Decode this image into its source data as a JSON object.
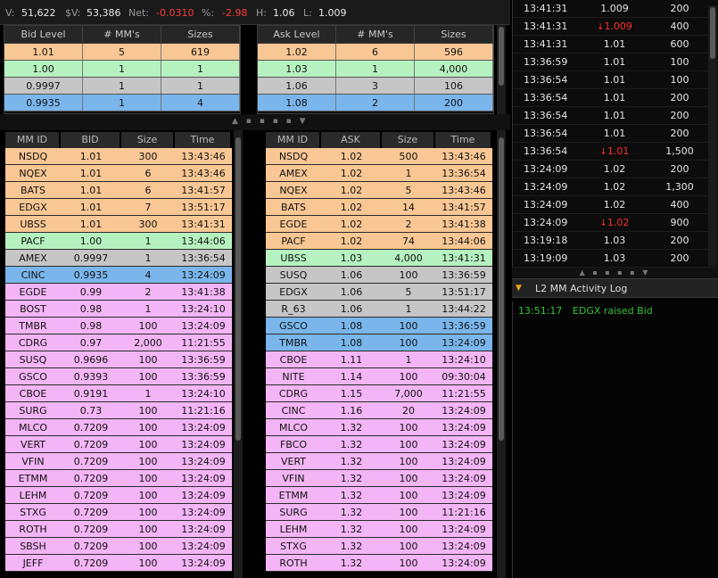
{
  "info": {
    "v_label": "V:",
    "v_value": "51,622",
    "dv_label": "$V:",
    "dv_value": "53,386",
    "net_label": "Net:",
    "net_value": "-0.0310",
    "pct_label": "%:",
    "pct_value": "-2.98",
    "h_label": "H:",
    "h_value": "1.06",
    "l_label": "L:",
    "l_value": "1.009"
  },
  "bid_summary": {
    "headers": [
      "Bid Level",
      "# MM's",
      "Sizes"
    ],
    "rows": [
      {
        "cells": [
          "1.01",
          "5",
          "619"
        ],
        "color": "orange"
      },
      {
        "cells": [
          "1.00",
          "1",
          "1"
        ],
        "color": "green"
      },
      {
        "cells": [
          "0.9997",
          "1",
          "1"
        ],
        "color": "gray"
      },
      {
        "cells": [
          "0.9935",
          "1",
          "4"
        ],
        "color": "blue"
      }
    ]
  },
  "ask_summary": {
    "headers": [
      "Ask Level",
      "# MM's",
      "Sizes"
    ],
    "rows": [
      {
        "cells": [
          "1.02",
          "6",
          "596"
        ],
        "color": "orange"
      },
      {
        "cells": [
          "1.03",
          "1",
          "4,000"
        ],
        "color": "green"
      },
      {
        "cells": [
          "1.06",
          "3",
          "106"
        ],
        "color": "gray"
      },
      {
        "cells": [
          "1.08",
          "2",
          "200"
        ],
        "color": "blue"
      }
    ]
  },
  "bid_montage": {
    "headers": [
      "MM ID",
      "BID",
      "Size",
      "Time"
    ],
    "rows": [
      {
        "cells": [
          "NSDQ",
          "1.01",
          "300",
          "13:43:46"
        ],
        "color": "orange"
      },
      {
        "cells": [
          "NQEX",
          "1.01",
          "6",
          "13:43:46"
        ],
        "color": "orange"
      },
      {
        "cells": [
          "BATS",
          "1.01",
          "6",
          "13:41:57"
        ],
        "color": "orange"
      },
      {
        "cells": [
          "EDGX",
          "1.01",
          "7",
          "13:51:17"
        ],
        "color": "orange"
      },
      {
        "cells": [
          "UBSS",
          "1.01",
          "300",
          "13:41:31"
        ],
        "color": "orange"
      },
      {
        "cells": [
          "PACF",
          "1.00",
          "1",
          "13:44:06"
        ],
        "color": "green"
      },
      {
        "cells": [
          "AMEX",
          "0.9997",
          "1",
          "13:36:54"
        ],
        "color": "gray"
      },
      {
        "cells": [
          "CINC",
          "0.9935",
          "4",
          "13:24:09"
        ],
        "color": "blue"
      },
      {
        "cells": [
          "EGDE",
          "0.99",
          "2",
          "13:41:38"
        ],
        "color": "pink"
      },
      {
        "cells": [
          "BOST",
          "0.98",
          "1",
          "13:24:10"
        ],
        "color": "pink"
      },
      {
        "cells": [
          "TMBR",
          "0.98",
          "100",
          "13:24:09"
        ],
        "color": "pink"
      },
      {
        "cells": [
          "CDRG",
          "0.97",
          "2,000",
          "11:21:55"
        ],
        "color": "pink"
      },
      {
        "cells": [
          "SUSQ",
          "0.9696",
          "100",
          "13:36:59"
        ],
        "color": "pink"
      },
      {
        "cells": [
          "GSCO",
          "0.9393",
          "100",
          "13:36:59"
        ],
        "color": "pink"
      },
      {
        "cells": [
          "CBOE",
          "0.9191",
          "1",
          "13:24:10"
        ],
        "color": "pink"
      },
      {
        "cells": [
          "SURG",
          "0.73",
          "100",
          "11:21:16"
        ],
        "color": "pink"
      },
      {
        "cells": [
          "MLCO",
          "0.7209",
          "100",
          "13:24:09"
        ],
        "color": "pink"
      },
      {
        "cells": [
          "VERT",
          "0.7209",
          "100",
          "13:24:09"
        ],
        "color": "pink"
      },
      {
        "cells": [
          "VFIN",
          "0.7209",
          "100",
          "13:24:09"
        ],
        "color": "pink"
      },
      {
        "cells": [
          "ETMM",
          "0.7209",
          "100",
          "13:24:09"
        ],
        "color": "pink"
      },
      {
        "cells": [
          "LEHM",
          "0.7209",
          "100",
          "13:24:09"
        ],
        "color": "pink"
      },
      {
        "cells": [
          "STXG",
          "0.7209",
          "100",
          "13:24:09"
        ],
        "color": "pink"
      },
      {
        "cells": [
          "ROTH",
          "0.7209",
          "100",
          "13:24:09"
        ],
        "color": "pink"
      },
      {
        "cells": [
          "SBSH",
          "0.7209",
          "100",
          "13:24:09"
        ],
        "color": "pink"
      },
      {
        "cells": [
          "JEFF",
          "0.7209",
          "100",
          "13:24:09"
        ],
        "color": "pink"
      }
    ]
  },
  "ask_montage": {
    "headers": [
      "MM ID",
      "ASK",
      "Size",
      "Time"
    ],
    "rows": [
      {
        "cells": [
          "NSDQ",
          "1.02",
          "500",
          "13:43:46"
        ],
        "color": "orange"
      },
      {
        "cells": [
          "AMEX",
          "1.02",
          "1",
          "13:36:54"
        ],
        "color": "orange"
      },
      {
        "cells": [
          "NQEX",
          "1.02",
          "5",
          "13:43:46"
        ],
        "color": "orange"
      },
      {
        "cells": [
          "BATS",
          "1.02",
          "14",
          "13:41:57"
        ],
        "color": "orange"
      },
      {
        "cells": [
          "EGDE",
          "1.02",
          "2",
          "13:41:38"
        ],
        "color": "orange"
      },
      {
        "cells": [
          "PACF",
          "1.02",
          "74",
          "13:44:06"
        ],
        "color": "orange"
      },
      {
        "cells": [
          "UBSS",
          "1.03",
          "4,000",
          "13:41:31"
        ],
        "color": "green"
      },
      {
        "cells": [
          "SUSQ",
          "1.06",
          "100",
          "13:36:59"
        ],
        "color": "gray"
      },
      {
        "cells": [
          "EDGX",
          "1.06",
          "5",
          "13:51:17"
        ],
        "color": "gray"
      },
      {
        "cells": [
          "R_63",
          "1.06",
          "1",
          "13:44:22"
        ],
        "color": "gray"
      },
      {
        "cells": [
          "GSCO",
          "1.08",
          "100",
          "13:36:59"
        ],
        "color": "blue"
      },
      {
        "cells": [
          "TMBR",
          "1.08",
          "100",
          "13:24:09"
        ],
        "color": "blue"
      },
      {
        "cells": [
          "CBOE",
          "1.11",
          "1",
          "13:24:10"
        ],
        "color": "pink"
      },
      {
        "cells": [
          "NITE",
          "1.14",
          "100",
          "09:30:04"
        ],
        "color": "pink"
      },
      {
        "cells": [
          "CDRG",
          "1.15",
          "7,000",
          "11:21:55"
        ],
        "color": "pink"
      },
      {
        "cells": [
          "CINC",
          "1.16",
          "20",
          "13:24:09"
        ],
        "color": "pink"
      },
      {
        "cells": [
          "MLCO",
          "1.32",
          "100",
          "13:24:09"
        ],
        "color": "pink"
      },
      {
        "cells": [
          "FBCO",
          "1.32",
          "100",
          "13:24:09"
        ],
        "color": "pink"
      },
      {
        "cells": [
          "VERT",
          "1.32",
          "100",
          "13:24:09"
        ],
        "color": "pink"
      },
      {
        "cells": [
          "VFIN",
          "1.32",
          "100",
          "13:24:09"
        ],
        "color": "pink"
      },
      {
        "cells": [
          "ETMM",
          "1.32",
          "100",
          "13:24:09"
        ],
        "color": "pink"
      },
      {
        "cells": [
          "SURG",
          "1.32",
          "100",
          "11:21:16"
        ],
        "color": "pink"
      },
      {
        "cells": [
          "LEHM",
          "1.32",
          "100",
          "13:24:09"
        ],
        "color": "pink"
      },
      {
        "cells": [
          "STXG",
          "1.32",
          "100",
          "13:24:09"
        ],
        "color": "pink"
      },
      {
        "cells": [
          "ROTH",
          "1.32",
          "100",
          "13:24:09"
        ],
        "color": "pink"
      }
    ]
  },
  "time_sales": [
    {
      "time": "13:41:31",
      "price": "1.009",
      "size": "200",
      "down": false
    },
    {
      "time": "13:41:31",
      "price": "1.009",
      "size": "400",
      "down": true
    },
    {
      "time": "13:41:31",
      "price": "1.01",
      "size": "600",
      "down": false
    },
    {
      "time": "13:36:59",
      "price": "1.01",
      "size": "100",
      "down": false
    },
    {
      "time": "13:36:54",
      "price": "1.01",
      "size": "100",
      "down": false
    },
    {
      "time": "13:36:54",
      "price": "1.01",
      "size": "200",
      "down": false
    },
    {
      "time": "13:36:54",
      "price": "1.01",
      "size": "200",
      "down": false
    },
    {
      "time": "13:36:54",
      "price": "1.01",
      "size": "200",
      "down": false
    },
    {
      "time": "13:36:54",
      "price": "1.01",
      "size": "1,500",
      "down": true
    },
    {
      "time": "13:24:09",
      "price": "1.02",
      "size": "200",
      "down": false
    },
    {
      "time": "13:24:09",
      "price": "1.02",
      "size": "1,300",
      "down": false
    },
    {
      "time": "13:24:09",
      "price": "1.02",
      "size": "400",
      "down": false
    },
    {
      "time": "13:24:09",
      "price": "1.02",
      "size": "900",
      "down": true
    },
    {
      "time": "13:19:18",
      "price": "1.03",
      "size": "200",
      "down": false
    },
    {
      "time": "13:19:09",
      "price": "1.03",
      "size": "200",
      "down": false
    }
  ],
  "activity_log": {
    "title": "L2 MM Activity Log",
    "entries": [
      {
        "time": "13:51:17",
        "text": "EDGX raised Bid"
      }
    ]
  },
  "colors": {
    "orange": "#f9c794",
    "green": "#b6f2c0",
    "gray": "#c6c6c6",
    "blue": "#7ab6ec",
    "pink": "#f3b5f5",
    "negative": "#ff3030",
    "log_text": "#34c234"
  }
}
